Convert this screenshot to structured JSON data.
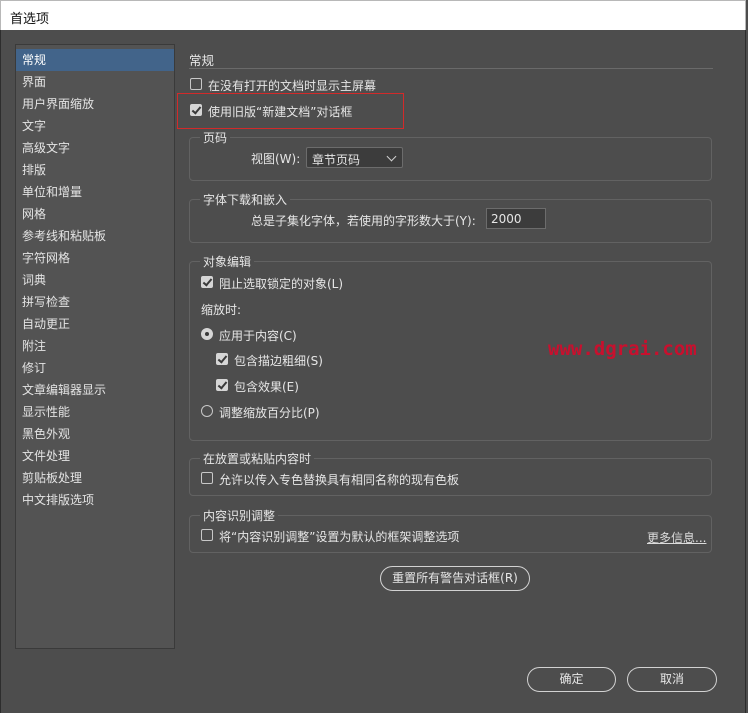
{
  "window": {
    "title": "首选项"
  },
  "sidebar": {
    "items": [
      {
        "label": "常规",
        "selected": true
      },
      {
        "label": "界面"
      },
      {
        "label": "用户界面缩放"
      },
      {
        "label": "文字"
      },
      {
        "label": "高级文字"
      },
      {
        "label": "排版"
      },
      {
        "label": "单位和增量"
      },
      {
        "label": "网格"
      },
      {
        "label": "参考线和粘贴板"
      },
      {
        "label": "字符网格"
      },
      {
        "label": "词典"
      },
      {
        "label": "拼写检查"
      },
      {
        "label": "自动更正"
      },
      {
        "label": "附注"
      },
      {
        "label": "修订"
      },
      {
        "label": "文章编辑器显示"
      },
      {
        "label": "显示性能"
      },
      {
        "label": "黑色外观"
      },
      {
        "label": "文件处理"
      },
      {
        "label": "剪贴板处理"
      },
      {
        "label": "中文排版选项"
      }
    ]
  },
  "main": {
    "title": "常规",
    "no_doc_home": {
      "label": "在没有打开的文档时显示主屏幕",
      "checked": false
    },
    "legacy_new_doc": {
      "label": "使用旧版“新建文档”对话框",
      "checked": true
    },
    "page_numbering": {
      "title": "页码",
      "view_label": "视图(W):",
      "view_value": "章节页码"
    },
    "font_download": {
      "title": "字体下载和嵌入",
      "subset_label": "总是子集化字体，若使用的字形数大于(Y):",
      "subset_value": "2000"
    },
    "object_editing": {
      "title": "对象编辑",
      "prevent_locked": {
        "label": "阻止选取锁定的对象(L)",
        "checked": true
      },
      "scaling_label": "缩放时:",
      "apply_content": {
        "label": "应用于内容(C)",
        "checked": true
      },
      "include_stroke": {
        "label": "包含描边粗细(S)",
        "checked": true
      },
      "include_effects": {
        "label": "包含效果(E)",
        "checked": true
      },
      "adjust_percent": {
        "label": "调整缩放百分比(P)",
        "checked": false
      }
    },
    "placing_pasting": {
      "title": "在放置或粘贴内容时",
      "allow_spot": {
        "label": "允许以传入专色替换具有相同名称的现有色板",
        "checked": false
      }
    },
    "content_aware": {
      "title": "内容识别调整",
      "set_default": {
        "label": "将“内容识别调整”设置为默认的框架调整选项",
        "checked": false
      },
      "more_info": "更多信息..."
    },
    "reset_warnings": "重置所有警告对话框(R)"
  },
  "footer": {
    "ok": "确定",
    "cancel": "取消"
  },
  "watermark": "www.dgrai.com",
  "colors": {
    "accent_selected": "#42648a",
    "highlight_box": "#d22a2a",
    "watermark": "#c8102e",
    "panel_bg": "#4d4d4d"
  }
}
